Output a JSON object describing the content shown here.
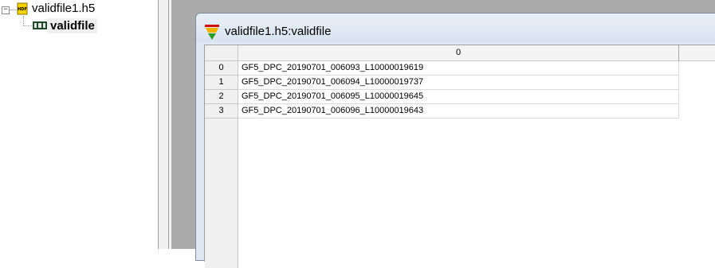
{
  "tree": {
    "expander_symbol": "⊟",
    "file_name": "validfile1.h5",
    "dataset_name": "validfile",
    "file_icon": "hdf-file-icon",
    "dataset_icon": "dataset-icon"
  },
  "window": {
    "title": "validfile1.h5:validfile",
    "title_icon": "dataset-table-icon"
  },
  "table": {
    "column_headers": [
      "0"
    ],
    "rows": [
      {
        "index": "0",
        "value": "GF5_DPC_20190701_006093_L10000019619"
      },
      {
        "index": "1",
        "value": "GF5_DPC_20190701_006094_L10000019737"
      },
      {
        "index": "2",
        "value": "GF5_DPC_20190701_006095_L10000019645"
      },
      {
        "index": "3",
        "value": "GF5_DPC_20190701_006096_L10000019643"
      }
    ]
  },
  "colors": {
    "mdi_background": "#ababab",
    "window_frame": "#dfe8f3",
    "header_bg": "#f4f4f4"
  }
}
